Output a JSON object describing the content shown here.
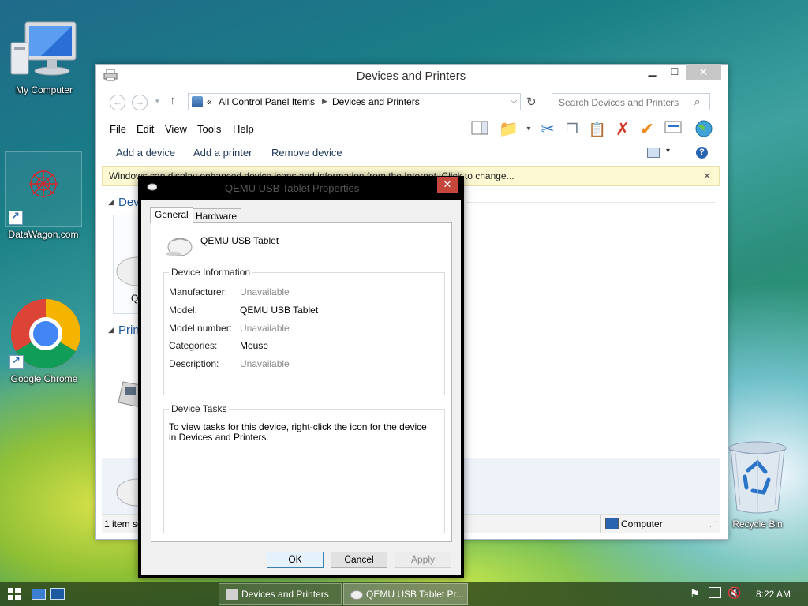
{
  "desktop": {
    "icons": [
      {
        "label": "My Computer"
      },
      {
        "label": "DataWagon.com"
      },
      {
        "label": "Google Chrome"
      },
      {
        "label": "Recycle Bin"
      }
    ]
  },
  "explorer": {
    "title": "Devices and Printers",
    "address": {
      "prefix": "«",
      "crumbs": [
        "All Control Panel Items",
        "Devices and Printers"
      ]
    },
    "search_placeholder": "Search Devices and Printers",
    "menu": [
      "File",
      "Edit",
      "View",
      "Tools",
      "Help"
    ],
    "commands": [
      "Add a device",
      "Add a printer",
      "Remove device"
    ],
    "infobar": "Windows can display enhanced device icons and information from the Internet. Click to change...",
    "sections": {
      "devices": "Dev",
      "printers": "Prin"
    },
    "device_partial_label": "Q",
    "status_left": "1 item se",
    "status_right": "Computer"
  },
  "dialog": {
    "title": "QEMU USB Tablet Properties",
    "tabs": [
      "General",
      "Hardware"
    ],
    "device_name": "QEMU USB Tablet",
    "device_info": {
      "title": "Device Information",
      "rows": [
        {
          "label": "Manufacturer:",
          "value": "Unavailable",
          "muted": true
        },
        {
          "label": "Model:",
          "value": "QEMU USB Tablet",
          "muted": false
        },
        {
          "label": "Model number:",
          "value": "Unavailable",
          "muted": true
        },
        {
          "label": "Categories:",
          "value": "Mouse",
          "muted": false
        },
        {
          "label": "Description:",
          "value": "Unavailable",
          "muted": true
        }
      ]
    },
    "device_tasks": {
      "title": "Device Tasks",
      "text": "To view tasks for this device, right-click the icon for the device in Devices and Printers."
    },
    "buttons": {
      "ok": "OK",
      "cancel": "Cancel",
      "apply": "Apply"
    }
  },
  "taskbar": {
    "tasks": [
      {
        "label": "Devices and Printers"
      },
      {
        "label": "QEMU USB Tablet Pr..."
      }
    ],
    "clock": "8:22 AM"
  },
  "colors": {
    "accent": "#1e5aa0",
    "close_red": "#c7463b",
    "muted_text": "#8a8a8a"
  }
}
